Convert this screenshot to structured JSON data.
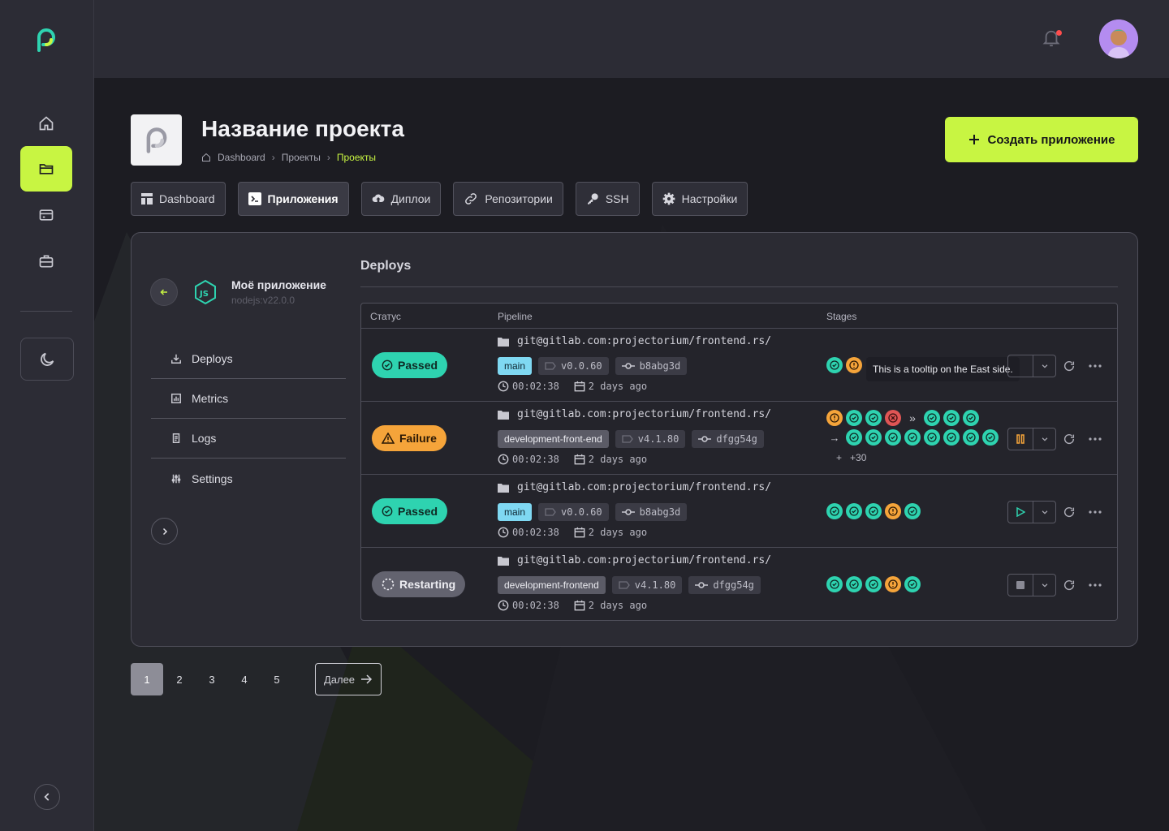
{
  "header": {
    "title": "Название проекта",
    "breadcrumb": [
      "Dashboard",
      "Проекты",
      "Проекты"
    ],
    "create_button": "Создать приложение"
  },
  "tabs": [
    {
      "label": "Dashboard",
      "icon": "dashboard-icon"
    },
    {
      "label": "Приложения",
      "icon": "terminal-icon",
      "active": true
    },
    {
      "label": "Диплои",
      "icon": "cloud-upload-icon"
    },
    {
      "label": "Репозитории",
      "icon": "link-icon"
    },
    {
      "label": "SSH",
      "icon": "key-icon"
    },
    {
      "label": "Настройки",
      "icon": "gear-icon"
    }
  ],
  "app": {
    "name": "Моё приложение",
    "version": "nodejs:v22.0.0"
  },
  "side_menu": [
    {
      "label": "Deploys",
      "icon": "download-icon"
    },
    {
      "label": "Metrics",
      "icon": "chart-icon"
    },
    {
      "label": "Logs",
      "icon": "document-icon"
    },
    {
      "label": "Settings",
      "icon": "sliders-icon"
    }
  ],
  "deploys": {
    "title": "Deploys",
    "columns": [
      "Статус",
      "Pipeline",
      "Stages"
    ],
    "tooltip": "This is a tooltip on the East side.",
    "rows": [
      {
        "status": "Passed",
        "repo": "git@gitlab.com:projectorium/frontend.rs/",
        "branch": "main",
        "tag": "v0.0.60",
        "commit": "b8abg3d",
        "duration": "00:02:38",
        "date": "2 days ago"
      },
      {
        "status": "Failure",
        "repo": "git@gitlab.com:projectorium/frontend.rs/",
        "branch": "development-front-end",
        "tag": "v4.1.80",
        "commit": "dfgg54g",
        "duration": "00:02:38",
        "date": "2 days ago",
        "more": "+30"
      },
      {
        "status": "Passed",
        "repo": "git@gitlab.com:projectorium/frontend.rs/",
        "branch": "main",
        "tag": "v0.0.60",
        "commit": "b8abg3d",
        "duration": "00:02:38",
        "date": "2 days ago"
      },
      {
        "status": "Restarting",
        "repo": "git@gitlab.com:projectorium/frontend.rs/",
        "branch": "development-frontend",
        "tag": "v4.1.80",
        "commit": "dfgg54g",
        "duration": "00:02:38",
        "date": "2 days ago"
      }
    ]
  },
  "pagination": {
    "pages": [
      "1",
      "2",
      "3",
      "4",
      "5"
    ],
    "current": "1",
    "next_label": "Далее"
  },
  "colors": {
    "accent": "#c8f542",
    "passed": "#2ed3b0",
    "failure": "#f5a43a",
    "error": "#e05555",
    "restarting": "#63636f",
    "branch_main": "#7fd8f2"
  }
}
